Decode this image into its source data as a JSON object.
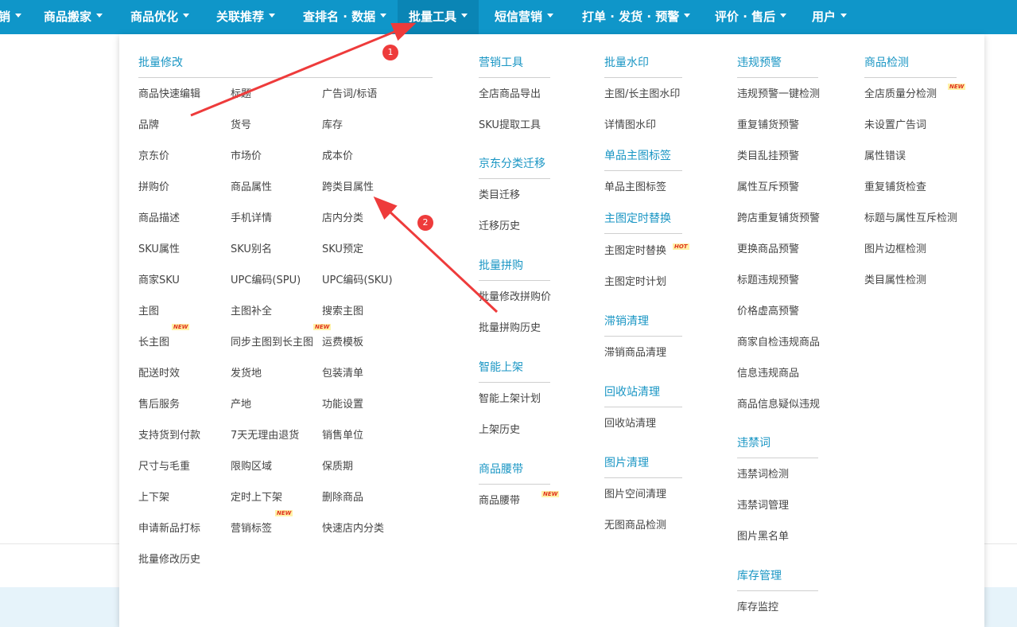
{
  "nav": {
    "items": [
      "销",
      "商品搬家",
      "商品优化",
      "关联推荐",
      "查排名 · 数据",
      "批量工具",
      "短信营销",
      "打单 · 发货 · 预警",
      "评价 · 售后",
      "用户"
    ]
  },
  "menu": {
    "batch_edit": {
      "title": "批量修改",
      "col1": [
        "商品快速编辑",
        "品牌",
        "京东价",
        "拼购价",
        "商品描述",
        "SKU属性",
        "商家SKU",
        "主图",
        "长主图",
        "配送时效",
        "售后服务",
        "支持货到付款",
        "尺寸与毛重",
        "上下架",
        "申请新品打标",
        "批量修改历史"
      ],
      "col2": [
        "标题",
        "货号",
        "市场价",
        "商品属性",
        "手机详情",
        "SKU别名",
        "UPC编码(SPU)",
        "主图补全",
        "同步主图到长主图",
        "发货地",
        "产地",
        "7天无理由退货",
        "限购区域",
        "定时上下架",
        "营销标签"
      ],
      "col3": [
        "广告词/标语",
        "库存",
        "成本价",
        "跨类目属性",
        "店内分类",
        "SKU预定",
        "UPC编码(SKU)",
        "搜索主图",
        "运费模板",
        "包装清单",
        "功能设置",
        "销售单位",
        "保质期",
        "删除商品",
        "快速店内分类"
      ]
    },
    "marketing": {
      "title": "营销工具",
      "items": [
        "全店商品导出",
        "SKU提取工具"
      ]
    },
    "jd_category": {
      "title": "京东分类迁移",
      "items": [
        "类目迁移",
        "迁移历史"
      ]
    },
    "group_buy": {
      "title": "批量拼购",
      "items": [
        "批量修改拼购价",
        "批量拼购历史"
      ]
    },
    "smart_listing": {
      "title": "智能上架",
      "items": [
        "智能上架计划",
        "上架历史"
      ]
    },
    "waistband": {
      "title": "商品腰带",
      "items": [
        "商品腰带"
      ]
    },
    "watermark": {
      "title": "批量水印",
      "items": [
        "主图/长主图水印",
        "详情图水印"
      ]
    },
    "main_tag": {
      "title": "单品主图标签",
      "items": [
        "单品主图标签"
      ]
    },
    "timed_replace": {
      "title": "主图定时替换",
      "items": [
        "主图定时替换",
        "主图定时计划"
      ]
    },
    "slow_clean": {
      "title": "滞销清理",
      "items": [
        "滞销商品清理"
      ]
    },
    "recycle": {
      "title": "回收站清理",
      "items": [
        "回收站清理"
      ]
    },
    "image_clean": {
      "title": "图片清理",
      "items": [
        "图片空间清理",
        "无图商品检测"
      ]
    },
    "violation": {
      "title": "违规预警",
      "items": [
        "违规预警一键检测",
        "重复铺货预警",
        "类目乱挂预警",
        "属性互斥预警",
        "跨店重复铺货预警",
        "更换商品预警",
        "标题违规预警",
        "价格虚高预警",
        "商家自检违规商品",
        "信息违规商品",
        "商品信息疑似违规"
      ]
    },
    "banned_words": {
      "title": "违禁词",
      "items": [
        "违禁词检测",
        "违禁词管理",
        "图片黑名单"
      ]
    },
    "inventory": {
      "title": "库存管理",
      "items": [
        "库存监控"
      ]
    },
    "product_check": {
      "title": "商品检测",
      "items": [
        "全店质量分检测",
        "未设置广告词",
        "属性错误",
        "重复铺货检查",
        "标题与属性互斥检测",
        "图片边框检测",
        "类目属性检测"
      ]
    }
  },
  "badges": {
    "new": "NEW",
    "hot": "HOT"
  },
  "annotations": {
    "marker_1": "1",
    "marker_2": "2"
  },
  "colors": {
    "nav_bg": "#0f96c9",
    "nav_active_bg": "#0a85b5",
    "section_title": "#1a96c4",
    "link": "#444444",
    "annotation": "#ee3b3b"
  }
}
